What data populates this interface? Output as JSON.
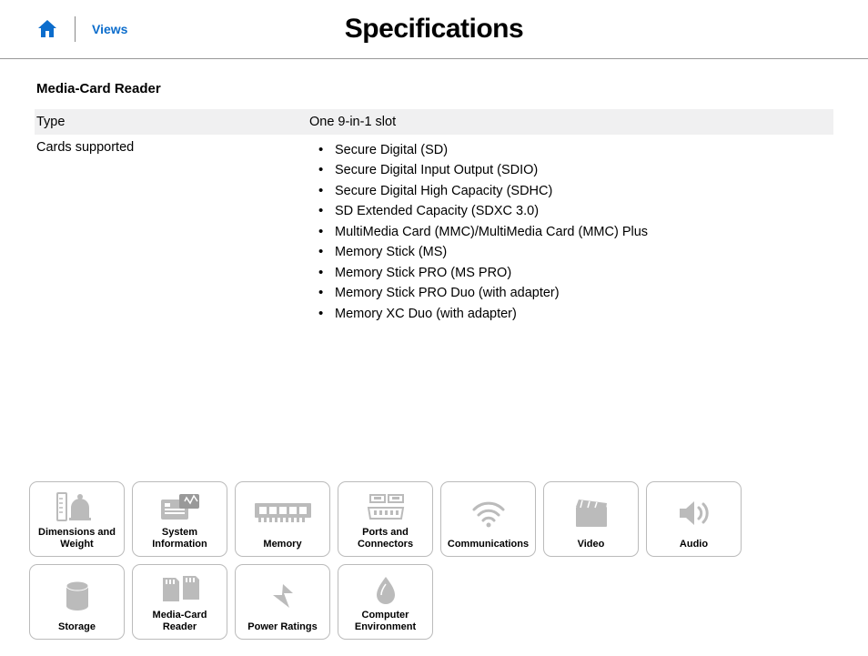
{
  "header": {
    "views_label": "Views",
    "title": "Specifications"
  },
  "section": {
    "title": "Media-Card Reader",
    "rows": [
      {
        "label": "Type",
        "value": "One 9-in-1 slot"
      },
      {
        "label": "Cards supported"
      }
    ],
    "cards_supported": [
      "Secure Digital (SD)",
      "Secure Digital Input Output (SDIO)",
      "Secure Digital High Capacity (SDHC)",
      "SD Extended Capacity (SDXC 3.0)",
      "MultiMedia Card (MMC)/MultiMedia Card (MMC) Plus",
      "Memory Stick (MS)",
      "Memory Stick PRO (MS PRO)",
      "Memory Stick PRO Duo (with adapter)",
      "Memory XC Duo (with adapter)"
    ]
  },
  "tiles": [
    {
      "id": "dimensions",
      "label": "Dimensions and\nWeight"
    },
    {
      "id": "system-info",
      "label": "System\nInformation"
    },
    {
      "id": "memory",
      "label": "Memory"
    },
    {
      "id": "ports",
      "label": "Ports and\nConnectors"
    },
    {
      "id": "communications",
      "label": "Communications"
    },
    {
      "id": "video",
      "label": "Video"
    },
    {
      "id": "audio",
      "label": "Audio"
    },
    {
      "id": "storage",
      "label": "Storage"
    },
    {
      "id": "media-card",
      "label": "Media-Card\nReader"
    },
    {
      "id": "power",
      "label": "Power Ratings"
    },
    {
      "id": "environment",
      "label": "Computer\nEnvironment"
    }
  ]
}
